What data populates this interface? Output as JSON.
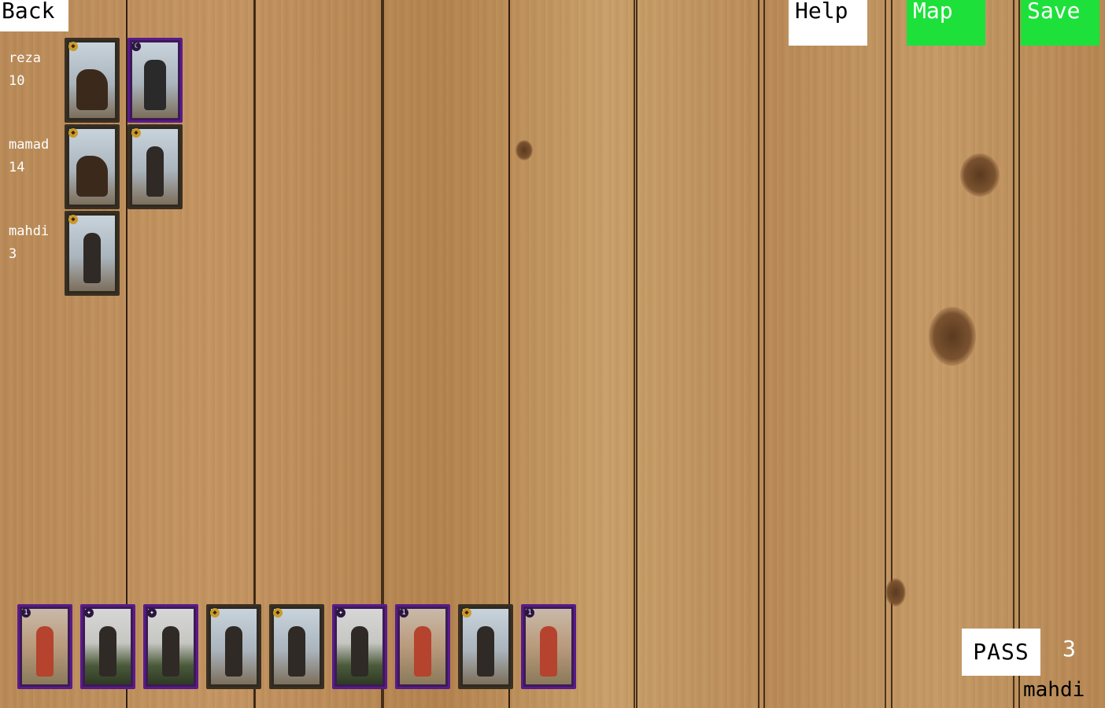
{
  "toolbar": {
    "back_label": "Back",
    "help_label": "Help",
    "map_label": "Map",
    "save_label": "Save",
    "colors": {
      "neutral": "#ffffff",
      "accent": "#1de13a"
    }
  },
  "players": [
    {
      "name": "reza",
      "score": "10"
    },
    {
      "name": "mamad",
      "score": "14"
    },
    {
      "name": "mahdi",
      "score": "3"
    }
  ],
  "hand": {
    "pass_label": "PASS",
    "pass_count": "3",
    "current_player": "mahdi"
  }
}
